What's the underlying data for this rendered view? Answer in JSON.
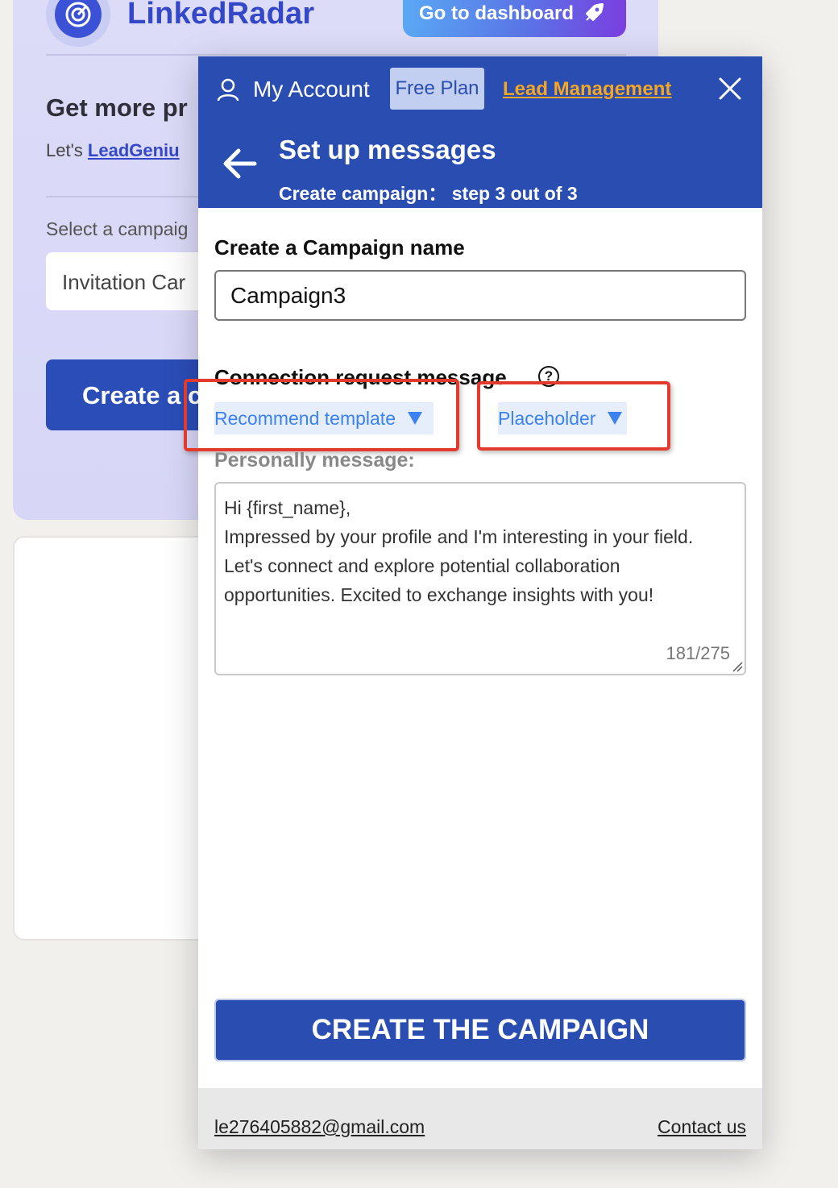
{
  "background": {
    "brand": "LinkedRadar",
    "dashboard_button": "Go to dashboard",
    "heading": "Get more pr",
    "lets_prefix": "Let's ",
    "lets_link": "LeadGeniu",
    "select_label": "Select a campaig",
    "select_value": "Invitation Car",
    "create_button": "Create a c"
  },
  "header": {
    "my_account": "My Account",
    "plan": "Free Plan",
    "lead_management": "Lead Management",
    "title": "Set up messages",
    "step": "Create campaign： step 3 out of 3"
  },
  "form": {
    "name_label": "Create a Campaign name",
    "name_value": "Campaign3",
    "connection_label": "Connection request message",
    "help_glyph": "?",
    "template_dropdown": "Recommend template",
    "placeholder_dropdown": "Placeholder",
    "personal_label": "Personally message:",
    "message": "Hi {first_name},\nImpressed by your profile and I'm interesting in your field. Let's connect and explore potential collaboration opportunities. Excited to exchange insights with you!",
    "counter": "181/275",
    "create_button": "CREATE THE CAMPAIGN"
  },
  "footer": {
    "email": "le276405882@gmail.com",
    "contact": "Contact us"
  },
  "colors": {
    "primary": "#2a4db2",
    "accent": "#f5a623",
    "link_blue": "#3b82f0",
    "highlight_red": "#e23b2e"
  },
  "icons": [
    "radar-logo-icon",
    "rocket-icon",
    "user-icon",
    "close-icon",
    "back-arrow-icon",
    "help-icon",
    "dropdown-arrow-icon",
    "resize-handle-icon"
  ]
}
